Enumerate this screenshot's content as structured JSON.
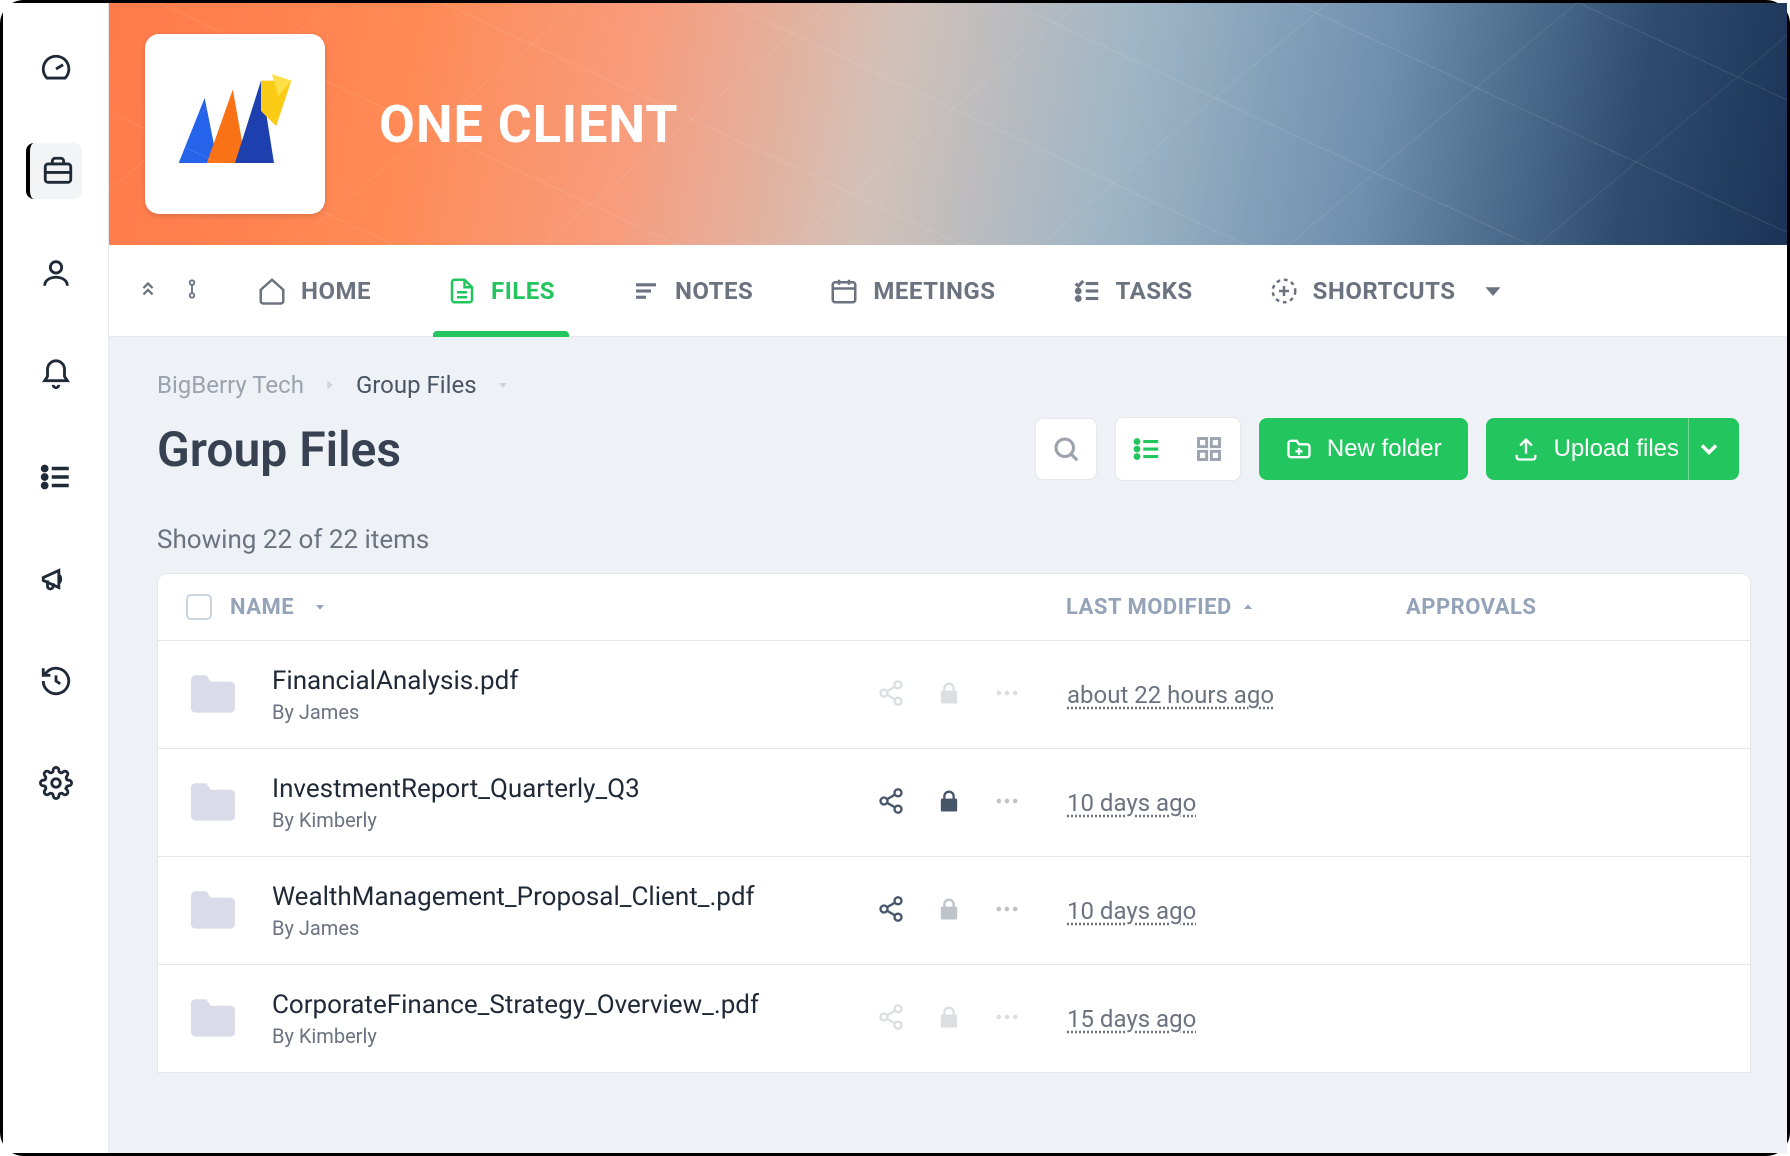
{
  "banner": {
    "title": "ONE CLIENT"
  },
  "tabs": {
    "home": "HOME",
    "files": "FILES",
    "notes": "NOTES",
    "meetings": "MEETINGS",
    "tasks": "TASKS",
    "shortcuts": "SHORTCUTS"
  },
  "breadcrumb": {
    "root": "BigBerry Tech",
    "current": "Group Files"
  },
  "page": {
    "title": "Group Files",
    "count_text": "Showing 22 of 22 items"
  },
  "buttons": {
    "new_folder": "New folder",
    "upload_files": "Upload files"
  },
  "table": {
    "headers": {
      "name": "NAME",
      "modified": "LAST MODIFIED",
      "approvals": "APPROVALS"
    },
    "rows": [
      {
        "name": "FinancialAnalysis.pdf",
        "author": "By James",
        "modified": "about 22 hours ago",
        "share_active": false,
        "lock_active": false
      },
      {
        "name": "InvestmentReport_Quarterly_Q3",
        "author": "By Kimberly",
        "modified": "10 days ago",
        "share_active": true,
        "lock_active": true
      },
      {
        "name": "WealthManagement_Proposal_Client_.pdf",
        "author": "By James",
        "modified": "10 days ago",
        "share_active": true,
        "lock_active": false
      },
      {
        "name": "CorporateFinance_Strategy_Overview_.pdf",
        "author": "By Kimberly",
        "modified": "15 days ago",
        "share_active": false,
        "lock_active": false
      }
    ]
  }
}
